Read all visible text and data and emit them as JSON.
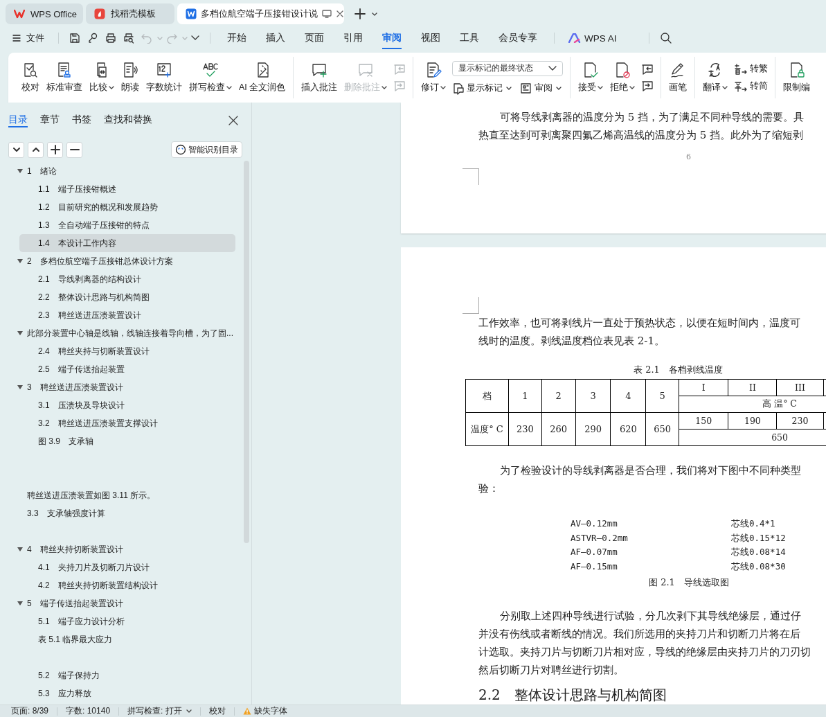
{
  "title_tabs": [
    {
      "label": "WPS Office",
      "kind": "home",
      "selected": false
    },
    {
      "label": "找稻壳模板",
      "kind": "template",
      "selected": false
    },
    {
      "label": "多档位航空端子压接钳设计说",
      "kind": "document",
      "selected": true
    }
  ],
  "menu": {
    "file": "文件",
    "tabs": [
      {
        "label": "开始",
        "selected": false
      },
      {
        "label": "插入",
        "selected": false
      },
      {
        "label": "页面",
        "selected": false
      },
      {
        "label": "引用",
        "selected": false
      },
      {
        "label": "审阅",
        "selected": true
      },
      {
        "label": "视图",
        "selected": false
      },
      {
        "label": "工具",
        "selected": false
      },
      {
        "label": "会员专享",
        "selected": false
      }
    ],
    "ai": "WPS AI"
  },
  "ribbon": {
    "groups": [
      {
        "items": [
          {
            "kind": "big",
            "label": "校对",
            "dropdown": false,
            "disabled": false
          },
          {
            "kind": "big",
            "label": "标准审查",
            "dropdown": false,
            "disabled": false
          },
          {
            "kind": "big",
            "label": "比较",
            "dropdown": true,
            "disabled": false
          },
          {
            "kind": "big",
            "label": "朗读",
            "dropdown": false,
            "disabled": false
          },
          {
            "kind": "big",
            "label": "字数统计",
            "dropdown": false,
            "disabled": false
          },
          {
            "kind": "big",
            "label": "拼写检查",
            "dropdown": true,
            "disabled": false
          },
          {
            "kind": "big",
            "label": "AI 全文润色",
            "dropdown": false,
            "disabled": false
          }
        ]
      },
      {
        "items": [
          {
            "kind": "big",
            "label": "插入批注",
            "dropdown": false,
            "disabled": false
          },
          {
            "kind": "big",
            "label": "删除批注",
            "dropdown": true,
            "disabled": true
          },
          {
            "kind": "stack",
            "buttons": [
              {
                "disabled": true
              },
              {
                "disabled": true
              }
            ]
          }
        ]
      },
      {
        "items": [
          {
            "kind": "big",
            "label": "修订",
            "dropdown": true,
            "disabled": false
          },
          {
            "kind": "combo",
            "value": "显示标记的最终状态",
            "buttons": [
              {
                "label": "显示标记",
                "dropdown": true
              },
              {
                "label": "审阅",
                "dropdown": true
              }
            ]
          }
        ]
      },
      {
        "items": [
          {
            "kind": "big",
            "label": "接受",
            "dropdown": true,
            "disabled": false
          },
          {
            "kind": "big",
            "label": "拒绝",
            "dropdown": true,
            "disabled": false
          },
          {
            "kind": "stack",
            "buttons": [
              {
                "disabled": false
              },
              {
                "disabled": false
              }
            ]
          }
        ]
      },
      {
        "items": [
          {
            "kind": "big",
            "label": "画笔",
            "dropdown": false,
            "disabled": false
          }
        ]
      },
      {
        "items": [
          {
            "kind": "big",
            "label": "翻译",
            "dropdown": true,
            "disabled": false
          },
          {
            "kind": "stack",
            "buttons": [
              {
                "label": "转繁",
                "disabled": false
              },
              {
                "label": "转简",
                "disabled": false
              }
            ]
          }
        ]
      },
      {
        "items": [
          {
            "kind": "big",
            "label": "限制编",
            "dropdown": false,
            "disabled": false
          }
        ]
      }
    ]
  },
  "sidebar": {
    "tabs": [
      {
        "label": "目录",
        "selected": true
      },
      {
        "label": "章节",
        "selected": false
      },
      {
        "label": "书签",
        "selected": false
      },
      {
        "label": "查找和替换",
        "selected": false
      }
    ],
    "smart_button": "智能识别目录",
    "toc": [
      {
        "number": "1",
        "title": "绪论",
        "expanded": true,
        "selected": false,
        "children": [
          {
            "number": "1.1",
            "title": "端子压接钳概述",
            "selected": false
          },
          {
            "number": "1.2",
            "title": "目前研究的概况和发展趋势",
            "selected": false
          },
          {
            "number": "1.3",
            "title": "全自动端子压接钳的特点",
            "selected": false
          },
          {
            "number": "1.4",
            "title": "本设计工作内容",
            "selected": true
          }
        ]
      },
      {
        "number": "2",
        "title": "多档位航空端子压接钳总体设计方案",
        "expanded": true,
        "selected": false,
        "children": [
          {
            "number": "2.1",
            "title": "导线剥离器的结构设计",
            "selected": false
          },
          {
            "number": "2.2",
            "title": "整体设计思路与机构简图",
            "selected": false
          },
          {
            "number": "2.3",
            "title": "聘丝送进压溃装置设计",
            "selected": false
          }
        ]
      },
      {
        "title": "此部分装置中心轴是线轴，线轴连接着导向槽，为了固...",
        "expanded": true,
        "selected": false,
        "children": [
          {
            "number": "2.4",
            "title": "聘丝夹持与切断装置设计",
            "selected": false
          },
          {
            "number": "2.5",
            "title": "端子传送抬起装置",
            "selected": false
          }
        ]
      },
      {
        "number": "3",
        "title": "聘丝送进压溃装置设计",
        "expanded": true,
        "selected": false,
        "children": [
          {
            "number": "3.1",
            "title": "压溃块及导块设计",
            "selected": false
          },
          {
            "number": "3.2",
            "title": "聘丝送进压溃装置支撑设计",
            "selected": false
          },
          {
            "title": "图 3.9　支承轴",
            "selected": false
          },
          {
            "kind": "blank"
          },
          {
            "kind": "blank"
          }
        ]
      },
      {
        "title": "聘丝送进压溃装置如图 3.11 所示。",
        "selected": false
      },
      {
        "number": "3.3",
        "title": "支承轴强度计算",
        "selected": false
      },
      {
        "kind": "blank"
      },
      {
        "number": "4",
        "title": "聘丝夹持切断装置设计",
        "expanded": true,
        "selected": false,
        "children": [
          {
            "number": "4.1",
            "title": "夹持刀片及切断刀片设计",
            "selected": false
          },
          {
            "number": "4.2",
            "title": "聘丝夹持切断装置结构设计",
            "selected": false
          }
        ]
      },
      {
        "number": "5",
        "title": "端子传送抬起装置设计",
        "expanded": true,
        "selected": false,
        "children": [
          {
            "number": "5.1",
            "title": "端子应力设计分析",
            "selected": false
          },
          {
            "title": "表 5.1 临界最大应力",
            "selected": false
          },
          {
            "kind": "blank"
          },
          {
            "number": "5.2",
            "title": "端子保持力",
            "selected": false
          },
          {
            "number": "5.3",
            "title": "应力释放",
            "selected": false
          }
        ]
      }
    ]
  },
  "document": {
    "page_1": {
      "lines": [
        {
          "text": "可将导线剥离器的温度分为 5 挡，为了满足不同种导线的需要。具",
          "indent": true
        },
        {
          "text": "热直至达到可剥离聚四氟乙烯高温线的温度分为 5 挡。此外为了缩短剥",
          "indent": false
        }
      ],
      "page_number": "6"
    },
    "page_2": {
      "lines": [
        {
          "text": "工作效率，也可将剥线片一直处于预热状态，以便在短时间内，温度可",
          "indent": false
        },
        {
          "text": "线时的温度。剥线温度档位表见表 2-1。",
          "indent": false
        }
      ],
      "table": {
        "caption": "表 2.1　各档剥线温度",
        "rows": [
          {
            "label": "档",
            "values": [
              "1",
              "2",
              "3",
              "4",
              "5"
            ],
            "levels": [
              "I",
              "II",
              "III"
            ],
            "group": "高 温° C"
          },
          {
            "label": "温度° C",
            "values": [
              "230",
              "260",
              "290",
              "620",
              "650"
            ],
            "levels": [
              "150",
              "190",
              "230"
            ],
            "group": "650"
          }
        ]
      },
      "lines_2": [
        {
          "text": "为了检验设计的导线剥离器是否合理，我们将对下图中不同种类型",
          "indent": true
        },
        {
          "text": "验：",
          "indent": false
        }
      ],
      "figure": {
        "rows": [
          {
            "wire": "AV—0.12mm",
            "core": "芯线0.4*1"
          },
          {
            "wire": "ASTVR—0.2mm",
            "core": "芯线0.15*12"
          },
          {
            "wire": "AF—0.07mm",
            "core": "芯线0.08*14"
          },
          {
            "wire": "AF—0.15mm",
            "core": "芯线0.08*30"
          }
        ],
        "caption": "图 2.1　导线选取图"
      },
      "lines_3": [
        {
          "text": "分别取上述四种导线进行试验，分几次剥下其导线绝缘层，通过仔",
          "indent": true
        },
        {
          "text": "并没有伤线或者断线的情况。我们所选用的夹持刀片和切断刀片将在后",
          "indent": false
        },
        {
          "text": "计选取。夹持刀片与切断刀片相对应，导线的绝缘层由夹持刀片的刀刃切",
          "indent": false
        },
        {
          "text": "然后切断刀片对聘丝进行切割。",
          "indent": false
        }
      ],
      "heading": "2.2　整体设计思路与机构简图"
    }
  },
  "status_bar": [
    {
      "label": "页面: 8/39",
      "kind": "text"
    },
    {
      "label": "字数: 10140",
      "kind": "text"
    },
    {
      "label": "拼写检查: 打开",
      "kind": "dropdown"
    },
    {
      "label": "校对",
      "kind": "text"
    },
    {
      "label": "缺失字体",
      "kind": "warning"
    }
  ]
}
